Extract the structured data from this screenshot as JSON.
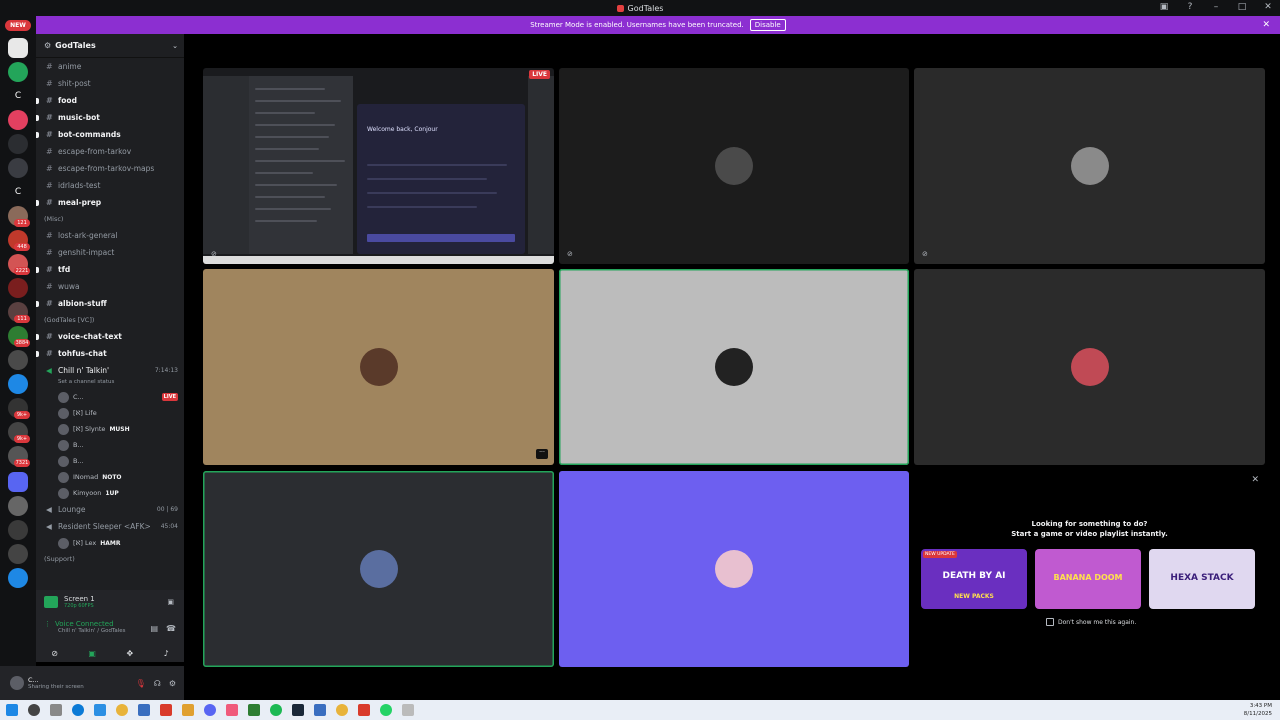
{
  "window": {
    "title": "GodTales"
  },
  "banner": {
    "text": "Streamer Mode is enabled. Usernames have been truncated.",
    "button": "Disable"
  },
  "rail": {
    "new_label": "NEW",
    "badges": [
      "121",
      "448",
      "2221",
      "111",
      "3884",
      "9k+",
      "9k+",
      "7321"
    ]
  },
  "server": {
    "name": "GodTales"
  },
  "channels_top": [
    {
      "name": "anime",
      "unread": false
    },
    {
      "name": "shit-post",
      "unread": false
    },
    {
      "name": "food",
      "unread": true
    },
    {
      "name": "music-bot",
      "unread": true
    },
    {
      "name": "bot-commands",
      "unread": true
    },
    {
      "name": "escape-from-tarkov",
      "unread": false
    },
    {
      "name": "escape-from-tarkov-maps",
      "unread": false
    },
    {
      "name": "idrlads-test",
      "unread": false
    },
    {
      "name": "meal-prep",
      "unread": true
    }
  ],
  "category_misc": "(Misc)",
  "channels_misc": [
    {
      "name": "lost-ark-general",
      "unread": false
    },
    {
      "name": "genshit-impact",
      "unread": false
    },
    {
      "name": "tfd",
      "unread": true
    },
    {
      "name": "wuwa",
      "unread": false
    },
    {
      "name": "albion-stuff",
      "unread": true
    }
  ],
  "category_vc": "(GodTales [VC])",
  "channels_vc": [
    {
      "name": "voice-chat-text",
      "unread": true
    },
    {
      "name": "tohfus-chat",
      "unread": true
    }
  ],
  "voice_channel": {
    "name": "Chill n' Talkin'",
    "timer": "7:14:13",
    "status": "Set a channel status"
  },
  "members": [
    {
      "name": "C...",
      "live": "LIVE"
    },
    {
      "name": "[ℵ] Life",
      "tag": ""
    },
    {
      "name": "[ℵ] Slynte",
      "tag": "MUSH"
    },
    {
      "name": "B...",
      "tag": ""
    },
    {
      "name": "B...",
      "tag": ""
    },
    {
      "name": "INomad",
      "tag": "NOTO"
    },
    {
      "name": "Kimyoon",
      "tag": "1UP"
    }
  ],
  "lounge": {
    "name": "Lounge",
    "meta": "00 | 69"
  },
  "resident": {
    "name": "Resident Sleeper <AFK>",
    "meta": "45:04"
  },
  "resident_member": {
    "name": "[ℵ] Lex",
    "tag": "HAMR"
  },
  "category_support": "(Support)",
  "screen": {
    "title": "Screen 1",
    "sub": "720p 60FPS"
  },
  "voice": {
    "status": "Voice Connected",
    "sub": "Chill n' Talkin' / GodTales"
  },
  "user": {
    "name": "C...",
    "status": "Sharing their screen"
  },
  "share": {
    "live": "LIVE",
    "welcome": "Welcome back, Conjour"
  },
  "promo": {
    "title_line1": "Looking for something to do?",
    "title_line2": "Start a game or video playlist instantly.",
    "cards": [
      {
        "name": "DEATH BY AI",
        "badge": "NEW UPDATE",
        "sub": "NEW PACKS"
      },
      {
        "name": "BANANA DOOM",
        "badge": "",
        "sub": ""
      },
      {
        "name": "HEXA STACK",
        "badge": "",
        "sub": ""
      }
    ],
    "dont_show": "Don't show me this again."
  },
  "clock": {
    "time": "3:43 PM",
    "date": "8/11/2025"
  },
  "colors": {
    "accent": "#8c2fd1",
    "green": "#23a55a",
    "red": "#da373c",
    "blurple": "#6d5ff0",
    "tan": "#a0855e",
    "grey": "#bcbcbc"
  }
}
